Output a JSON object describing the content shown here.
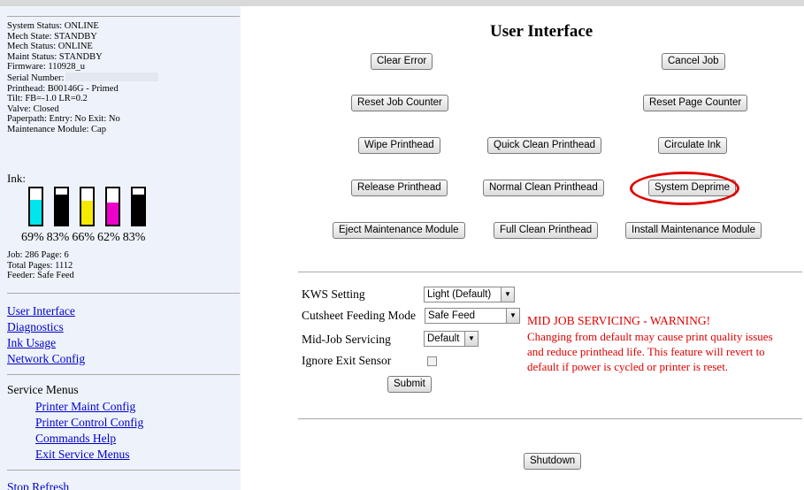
{
  "sidebar": {
    "status": {
      "system": "System Status: ONLINE",
      "mech_state": "Mech State: STANDBY",
      "mech_status": "Mech Status: ONLINE",
      "maint_status": "Maint Status: STANDBY",
      "firmware": "Firmware: 110928_u",
      "serial": "Serial Number:",
      "printhead": "Printhead: B00146G - Primed",
      "tilt": "Tilt: FB=-1.0 LR=0.2",
      "valve": "Valve: Closed",
      "paperpath": "Paperpath: Entry: No Exit: No",
      "maint_module": "Maintenance Module: Cap"
    },
    "ink": {
      "label": "Ink:",
      "tanks": [
        {
          "color": "#00e5ee",
          "level": 0.69,
          "pct": "69%"
        },
        {
          "color": "#000000",
          "level": 0.83,
          "pct": "83%"
        },
        {
          "color": "#f5e900",
          "level": 0.66,
          "pct": "66%"
        },
        {
          "color": "#ee00cc",
          "level": 0.62,
          "pct": "62%"
        },
        {
          "color": "#000000",
          "level": 0.83,
          "pct": "83%"
        }
      ]
    },
    "job": {
      "job_page": "Job: 286 Page: 6",
      "total_pages": "Total Pages: 1112",
      "feeder": "Feeder: Safe Feed"
    },
    "nav": {
      "user_interface": "User Interface",
      "diagnostics": "Diagnostics",
      "ink_usage": "Ink Usage",
      "network_config": "Network Config"
    },
    "service": {
      "title": "Service Menus",
      "printer_maint": "Printer Maint Config",
      "printer_control": "Printer Control Config",
      "commands_help": "Commands Help",
      "exit": "Exit Service Menus"
    },
    "stop_refresh": "Stop Refresh"
  },
  "main": {
    "title": "User Interface",
    "buttons": {
      "clear_error": "Clear Error",
      "cancel_job": "Cancel Job",
      "reset_job_counter": "Reset Job Counter",
      "reset_page_counter": "Reset Page Counter",
      "wipe_printhead": "Wipe Printhead",
      "quick_clean": "Quick Clean Printhead",
      "circulate_ink": "Circulate Ink",
      "release_printhead": "Release Printhead",
      "normal_clean": "Normal Clean Printhead",
      "system_deprime": "System Deprime",
      "eject_maint": "Eject Maintenance Module",
      "full_clean": "Full Clean Printhead",
      "install_maint": "Install Maintenance Module",
      "submit": "Submit",
      "shutdown": "Shutdown"
    },
    "form": {
      "kws_label": "KWS Setting",
      "kws_value": "Light (Default)",
      "cutsheet_label": "Cutsheet Feeding Mode",
      "cutsheet_value": "Safe Feed",
      "midjob_label": "Mid-Job Servicing",
      "midjob_value": "Default",
      "ignore_exit_label": "Ignore Exit Sensor"
    },
    "warning": {
      "title": "MID JOB SERVICING - WARNING!",
      "line1": "Changing from default may cause print quality issues",
      "line2": "and reduce printhead life. This feature will revert to",
      "line3": "default if power is cycled or printer is reset."
    }
  },
  "colors": {
    "sidebar_bg": "#eef3fb",
    "link": "#0000cc",
    "warning": "#e00000",
    "highlight_circle": "#e00000"
  }
}
